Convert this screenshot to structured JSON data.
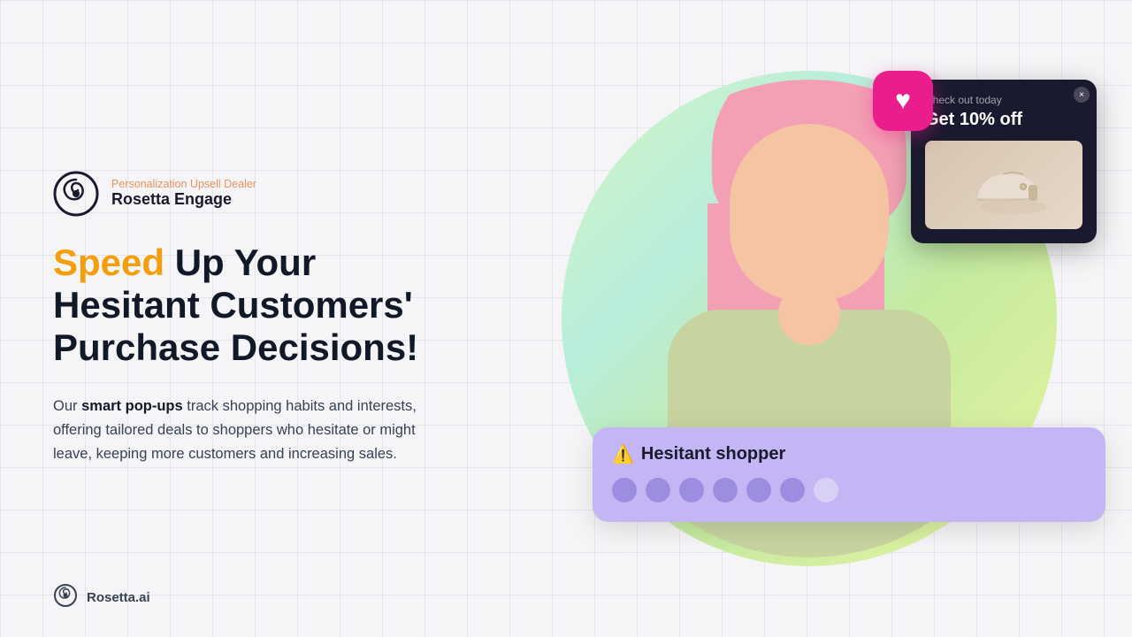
{
  "brand": {
    "logo_subtitle": "Personalization Upsell Dealer",
    "logo_title_regular": "Rosetta ",
    "logo_title_bold": "Engage",
    "bottom_logo_text": "Rosetta.ai"
  },
  "headline": {
    "speed": "Speed",
    "rest": " Up Your\nHesitant Customers'\nPurchase Decisions!"
  },
  "description": {
    "prefix": "Our ",
    "bold_text": "smart pop-ups",
    "suffix": " track shopping habits and interests, offering tailored deals to shoppers who hesitate or might leave, keeping more customers and increasing sales."
  },
  "notification_card": {
    "check_today": "Check out today",
    "discount": "Get 10% off",
    "close_label": "×"
  },
  "hesitant_badge": {
    "warning_icon": "⚠️",
    "title": "Hesitant shopper",
    "dots": [
      {
        "id": 1,
        "filled": true
      },
      {
        "id": 2,
        "filled": true
      },
      {
        "id": 3,
        "filled": true
      },
      {
        "id": 4,
        "filled": true
      },
      {
        "id": 5,
        "filled": true
      },
      {
        "id": 6,
        "filled": true
      },
      {
        "id": 7,
        "filled": false
      }
    ]
  },
  "heart_badge": {
    "icon": "♥"
  },
  "colors": {
    "speed_color": "#f59e0b",
    "brand_color": "#e91e8c",
    "badge_bg": "#c4b5f4",
    "dot_filled": "#9c8de0",
    "dot_empty": "#d8d0f5"
  }
}
